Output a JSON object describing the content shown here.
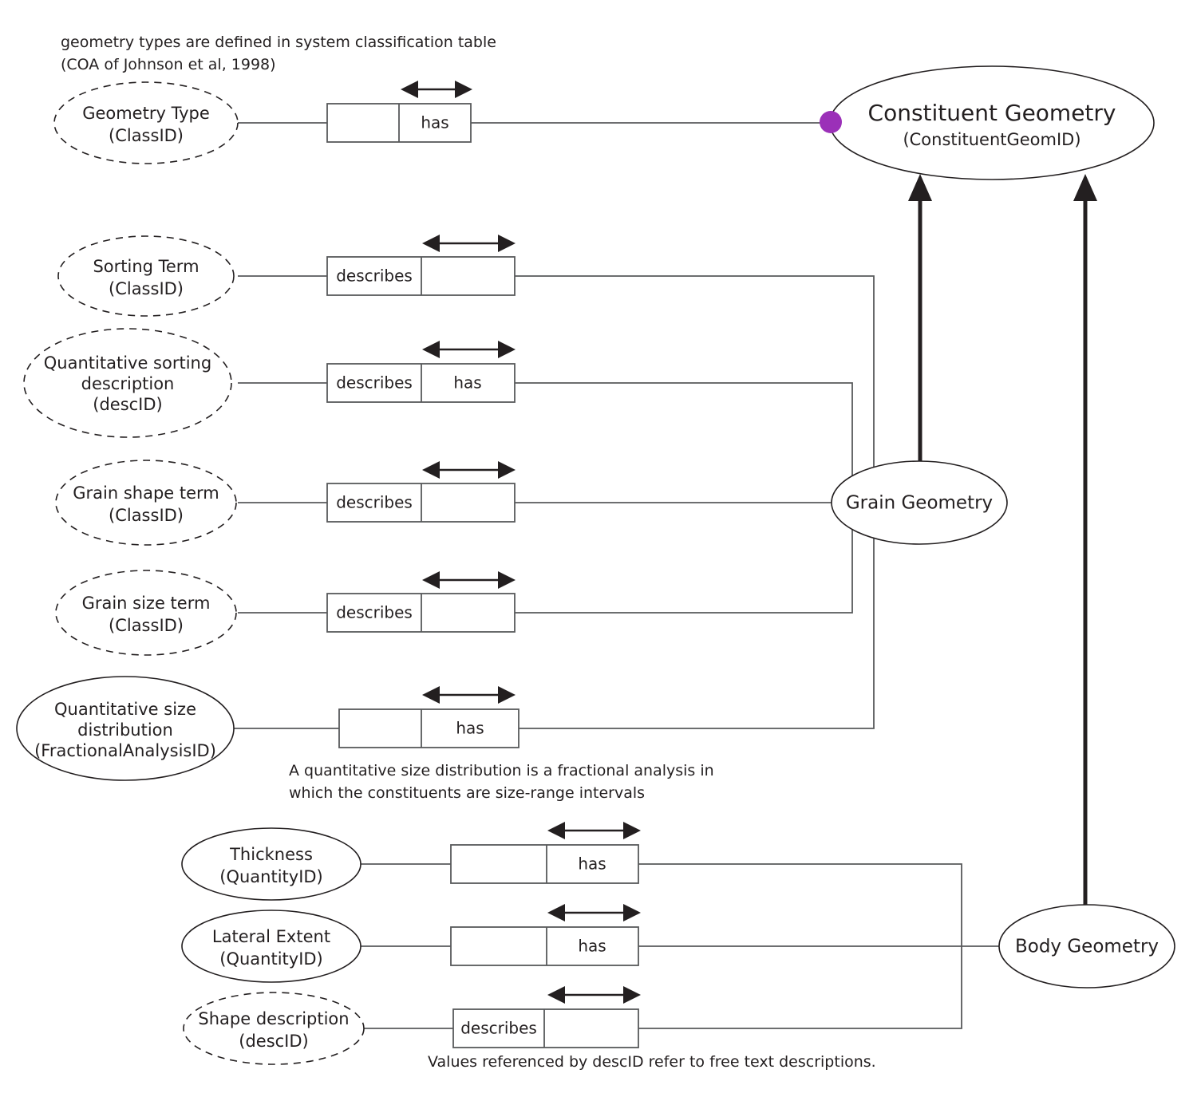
{
  "diagram": {
    "title": "Constituent Geometry ER diagram",
    "colors": {
      "accent_dot": "#9B30B8",
      "line": "#58595b",
      "text": "#231f20",
      "background": "#ffffff"
    },
    "notes": [
      {
        "id": "note-classification",
        "line1": "geometry types are defined in system classification table",
        "line2": "(COA of Johnson et al, 1998)"
      },
      {
        "id": "note-fractional-analysis",
        "line1": "A quantitative size distribution is a fractional analysis in",
        "line2": "which the constituents are size-range intervals"
      },
      {
        "id": "note-descid",
        "line1": "Values referenced by descID refer to free text descriptions.",
        "line2": ""
      }
    ],
    "entities": {
      "constituent_geometry": {
        "name": "Constituent Geometry",
        "key": "(ConstituentGeomID)",
        "style": "solid"
      },
      "grain_geometry": {
        "name": "Grain Geometry",
        "key": "",
        "style": "solid"
      },
      "body_geometry": {
        "name": "Body Geometry",
        "key": "",
        "style": "solid"
      },
      "geometry_type": {
        "name": "Geometry Type",
        "key": "(ClassID)",
        "style": "dashed"
      },
      "sorting_term": {
        "name": "Sorting Term",
        "key": "(ClassID)",
        "style": "dashed"
      },
      "quant_sorting_desc": {
        "name_line1": "Quantitative sorting",
        "name_line2": "description",
        "key": "(descID)",
        "style": "dashed"
      },
      "grain_shape_term": {
        "name": "Grain shape term",
        "key": "(ClassID)",
        "style": "dashed"
      },
      "grain_size_term": {
        "name": "Grain size term",
        "key": "(ClassID)",
        "style": "dashed"
      },
      "quant_size_dist": {
        "name_line1": "Quantitative size",
        "name_line2": "distribution",
        "key": "(FractionalAnalysisID)",
        "style": "solid"
      },
      "thickness": {
        "name": "Thickness",
        "key": "(QuantityID)",
        "style": "solid"
      },
      "lateral_extent": {
        "name": "Lateral Extent",
        "key": "(QuantityID)",
        "style": "solid"
      },
      "shape_description": {
        "name": "Shape description",
        "key": "(descID)",
        "style": "dashed"
      }
    },
    "relationships": [
      {
        "id": "rel-geometry-type",
        "left_label": "",
        "right_label": "has"
      },
      {
        "id": "rel-sorting-term",
        "left_label": "describes",
        "right_label": ""
      },
      {
        "id": "rel-quant-sorting",
        "left_label": "describes",
        "right_label": "has"
      },
      {
        "id": "rel-grain-shape",
        "left_label": "describes",
        "right_label": ""
      },
      {
        "id": "rel-grain-size",
        "left_label": "describes",
        "right_label": ""
      },
      {
        "id": "rel-quant-size-dist",
        "left_label": "",
        "right_label": "has"
      },
      {
        "id": "rel-thickness",
        "left_label": "",
        "right_label": "has"
      },
      {
        "id": "rel-lateral-extent",
        "left_label": "",
        "right_label": "has"
      },
      {
        "id": "rel-shape-description",
        "left_label": "describes",
        "right_label": ""
      }
    ]
  }
}
